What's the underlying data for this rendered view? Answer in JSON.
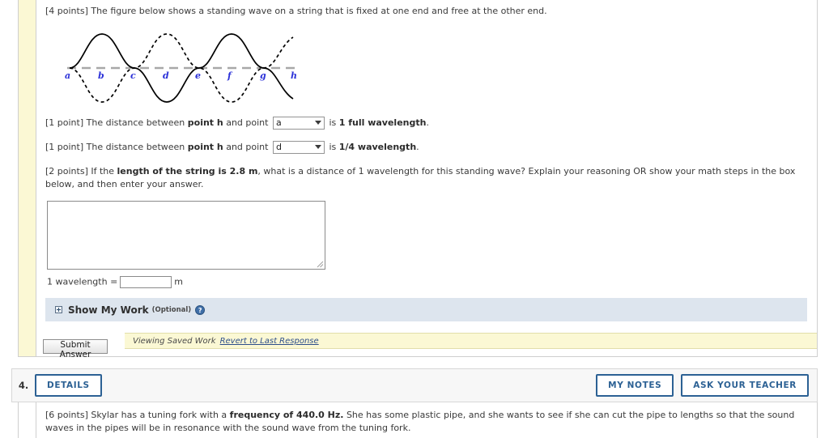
{
  "question3": {
    "prompt": "[4 points] The figure below shows a standing wave on a string that is fixed at one end and free at the other end.",
    "figure": {
      "labels": [
        "a",
        "b",
        "c",
        "d",
        "e",
        "f",
        "g",
        "h"
      ],
      "label_color": "#2b31d8",
      "axis_color": "#a8a8a8",
      "curve_color": "#000000"
    },
    "sub1": {
      "prefix": "[1 point] The distance between ",
      "point_label": "point h",
      "mid": " and point ",
      "select_value": "a",
      "suffix_lead": " is ",
      "suffix_bold": "1 full wavelength",
      "period": "."
    },
    "sub2": {
      "prefix": "[1 point] The distance between ",
      "point_label": "point h",
      "mid": " and point ",
      "select_value": "d",
      "suffix_lead": " is ",
      "suffix_bold": "1/4 wavelength",
      "period": "."
    },
    "sub3": {
      "prefix": "[2 points] If the ",
      "bold_lead": "length of the string is ",
      "value": "2.8",
      "unit_bold": " m",
      "rest": ", what is a distance of 1 wavelength for this standing wave? Explain your reasoning OR show your math steps in the box below, and then enter your answer.",
      "value_color": "#e8442a"
    },
    "work_textarea_value": "",
    "work_textarea_placeholder": "",
    "answer_label": "1 wavelength =",
    "answer_value": "",
    "answer_unit": "m",
    "show_my_work": {
      "title": "Show My Work",
      "optional": "(Optional)",
      "help_icon": "help-icon",
      "expand_icon": "plus-box-icon"
    },
    "submit_label": "Submit Answer",
    "saved_status": "Viewing Saved Work",
    "revert_link": "Revert to Last Response"
  },
  "question4": {
    "number": "4.",
    "details_label": "DETAILS",
    "my_notes_label": "MY NOTES",
    "ask_teacher_label": "ASK YOUR TEACHER",
    "prompt_prefix": "[6 points] Skylar has a tuning fork with a ",
    "prompt_bold": "frequency of ",
    "prompt_value": "440.0",
    "prompt_unit": " Hz.",
    "prompt_rest": " She has some plastic pipe, and she wants to see if she can cut the pipe to lengths so that the sound waves in the pipes will be in resonance with the sound wave from the tuning fork.",
    "value_color": "#e8442a"
  }
}
